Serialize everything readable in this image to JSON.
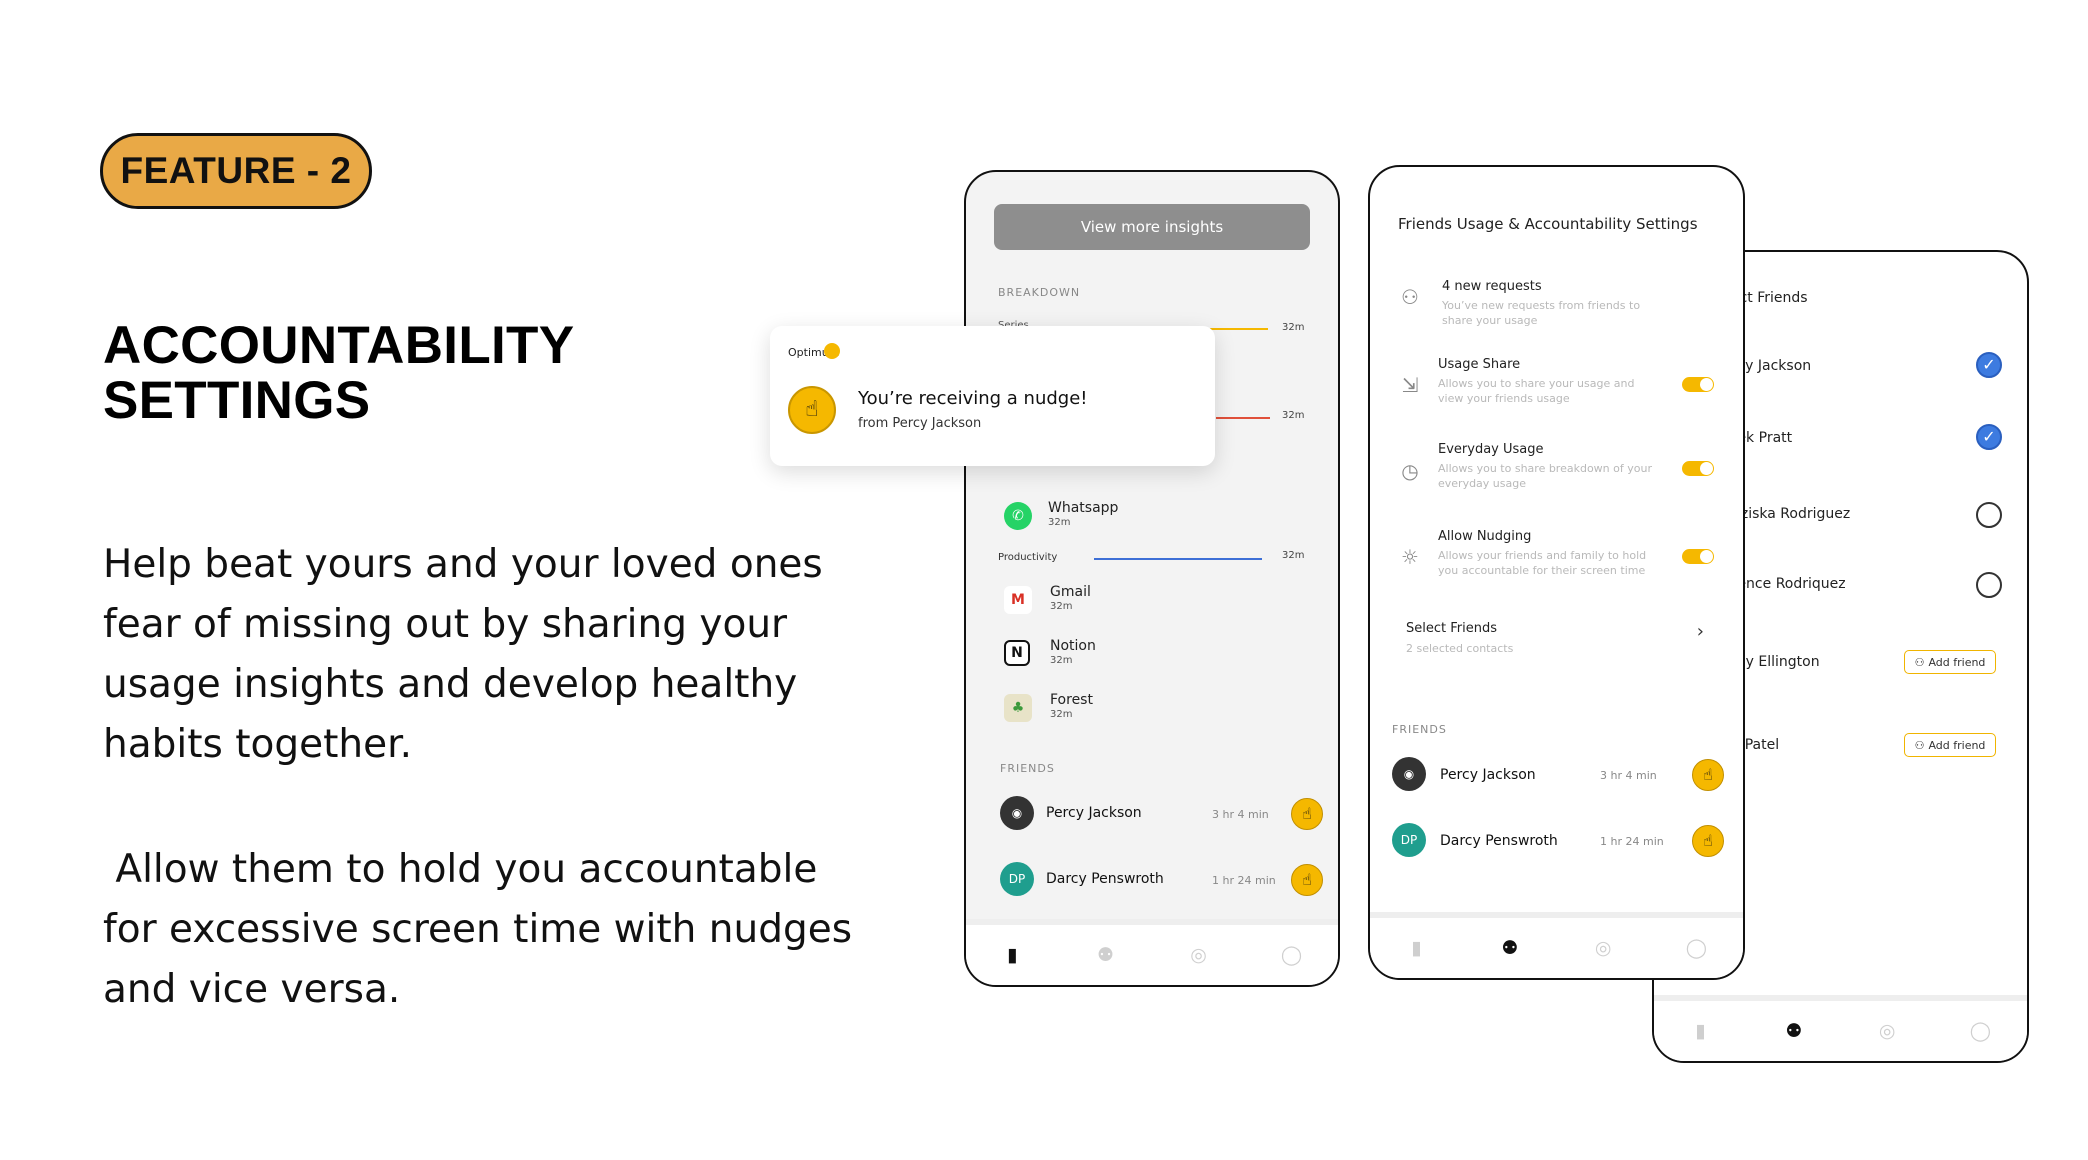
{
  "feature_badge": "FEATURE - 2",
  "heading_line1": "ACCOUNTABILITY",
  "heading_line2": "SETTINGS",
  "paragraph1": "Help beat yours and your loved ones fear of missing out by sharing your usage insights and develop healthy habits together.",
  "paragraph2": " Allow them to hold you accountable for excessive screen time with nudges and vice versa.",
  "notification": {
    "app": "Optimum",
    "title": "You’re receiving a nudge!",
    "subtitle": "from Percy Jackson"
  },
  "phone1": {
    "view_more_button": "View more insights",
    "breakdown_label": "BREAKDOWN",
    "category_partial": "Series",
    "bar_min_1": "32m",
    "bar_min_2": "32m",
    "whatsapp": {
      "name": "Whatsapp",
      "time": "32m"
    },
    "productivity": {
      "label": "Productivity",
      "time": "32m"
    },
    "apps": [
      {
        "name": "Gmail",
        "time": "32m"
      },
      {
        "name": "Notion",
        "time": "32m"
      },
      {
        "name": "Forest",
        "time": "32m"
      }
    ],
    "friends_label": "FRIENDS",
    "friends": [
      {
        "name": "Percy Jackson",
        "time": "3 hr 4 min"
      },
      {
        "name": "Darcy Penswroth",
        "initials": "DP",
        "time": "1 hr 24 min"
      }
    ]
  },
  "phone2": {
    "title": "Friends Usage & Accountability Settings",
    "requests": {
      "title": "4 new requests",
      "desc": "You’ve new requests from friends to share your usage"
    },
    "settings": [
      {
        "title": "Usage Share",
        "desc": "Allows you to share your usage and view your friends usage",
        "on": true
      },
      {
        "title": "Everyday Usage",
        "desc": "Allows you to share breakdown of your everyday usage",
        "on": true
      },
      {
        "title": "Allow Nudging",
        "desc": "Allows your friends and family to hold you accountable for their screen time",
        "on": true
      }
    ],
    "select_friends": {
      "title": "Select Friends",
      "desc": "2 selected contacts"
    },
    "friends_label": "FRIENDS",
    "friends": [
      {
        "name": "Percy Jackson",
        "time": "3 hr 4 min"
      },
      {
        "name": "Darcy Penswroth",
        "initials": "DP",
        "time": "1 hr 24 min"
      }
    ]
  },
  "phone3": {
    "title": "ect Friends",
    "contacts": [
      {
        "name": "rcy Jackson",
        "state": "checked"
      },
      {
        "name": "rek Pratt",
        "state": "checked"
      },
      {
        "name": "nziska Rodriguez",
        "state": "unchecked"
      },
      {
        "name": "rence Rodriquez",
        "state": "unchecked"
      },
      {
        "name": "my Ellington",
        "state": "add"
      },
      {
        "name": "y Patel",
        "state": "add"
      }
    ],
    "add_friend_label": "Add friend"
  },
  "colors": {
    "badge": "#e9a946",
    "accent_yellow": "#f5b800",
    "check_blue": "#3d7be0",
    "avatar_teal": "#1f9e8e",
    "bar_orange": "#f5b800",
    "bar_red": "#e0503a",
    "bar_blue": "#3d6fd6"
  }
}
